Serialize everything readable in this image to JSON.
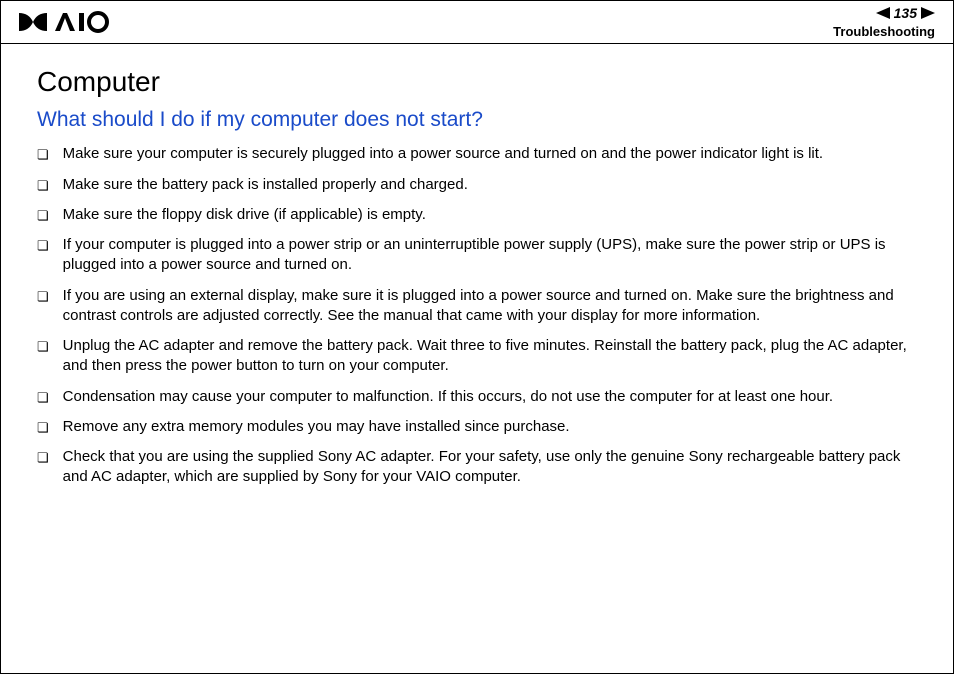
{
  "header": {
    "page_number": "135",
    "section": "Troubleshooting"
  },
  "content": {
    "title": "Computer",
    "subtitle": "What should I do if my computer does not start?",
    "items": [
      "Make sure your computer is securely plugged into a power source and turned on and the power indicator light is lit.",
      "Make sure the battery pack is installed properly and charged.",
      "Make sure the floppy disk drive (if applicable) is empty.",
      "If your computer is plugged into a power strip or an uninterruptible power supply (UPS), make sure the power strip or UPS is plugged into a power source and turned on.",
      "If you are using an external display, make sure it is plugged into a power source and turned on. Make sure the brightness and contrast controls are adjusted correctly. See the manual that came with your display for more information.",
      "Unplug the AC adapter and remove the battery pack. Wait three to five minutes. Reinstall the battery pack, plug the AC adapter, and then press the power button to turn on your computer.",
      "Condensation may cause your computer to malfunction. If this occurs, do not use the computer for at least one hour.",
      "Remove any extra memory modules you may have installed since purchase.",
      "Check that you are using the supplied Sony AC adapter. For your safety, use only the genuine Sony rechargeable battery pack and AC adapter, which are supplied by Sony for your VAIO computer."
    ]
  }
}
